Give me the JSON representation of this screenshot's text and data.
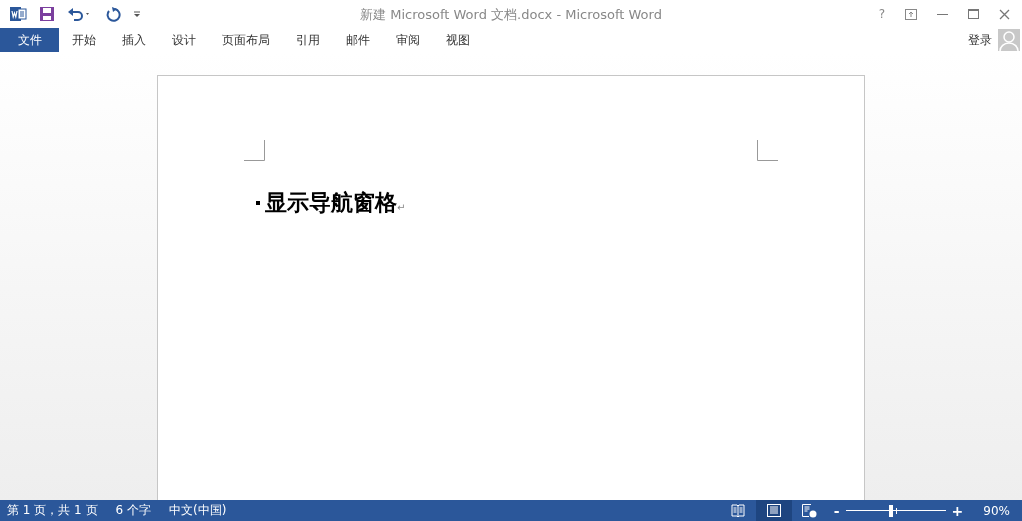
{
  "window": {
    "title": "新建 Microsoft Word 文档.docx - Microsoft Word"
  },
  "ribbon_tabs": [
    {
      "label": "文件",
      "kind": "file"
    },
    {
      "label": "开始",
      "kind": "tab"
    },
    {
      "label": "插入",
      "kind": "tab"
    },
    {
      "label": "设计",
      "kind": "tab"
    },
    {
      "label": "页面布局",
      "kind": "tab"
    },
    {
      "label": "引用",
      "kind": "tab"
    },
    {
      "label": "邮件",
      "kind": "tab"
    },
    {
      "label": "审阅",
      "kind": "tab"
    },
    {
      "label": "视图",
      "kind": "tab"
    }
  ],
  "help": "?",
  "sign_in": "登录",
  "document": {
    "heading": "显示导航窗格",
    "paragraph_mark": "↵"
  },
  "status_bar": {
    "page": "第 1 页，共 1 页",
    "words": "6 个字",
    "language": "中文(中国)",
    "views": [
      {
        "kind": "read",
        "selected": false
      },
      {
        "kind": "print",
        "selected": true
      },
      {
        "kind": "web",
        "selected": false
      }
    ],
    "zoom_minus": "-",
    "zoom_plus": "+",
    "zoom": {
      "level": 0.45
    },
    "zoom_label": "90%"
  }
}
